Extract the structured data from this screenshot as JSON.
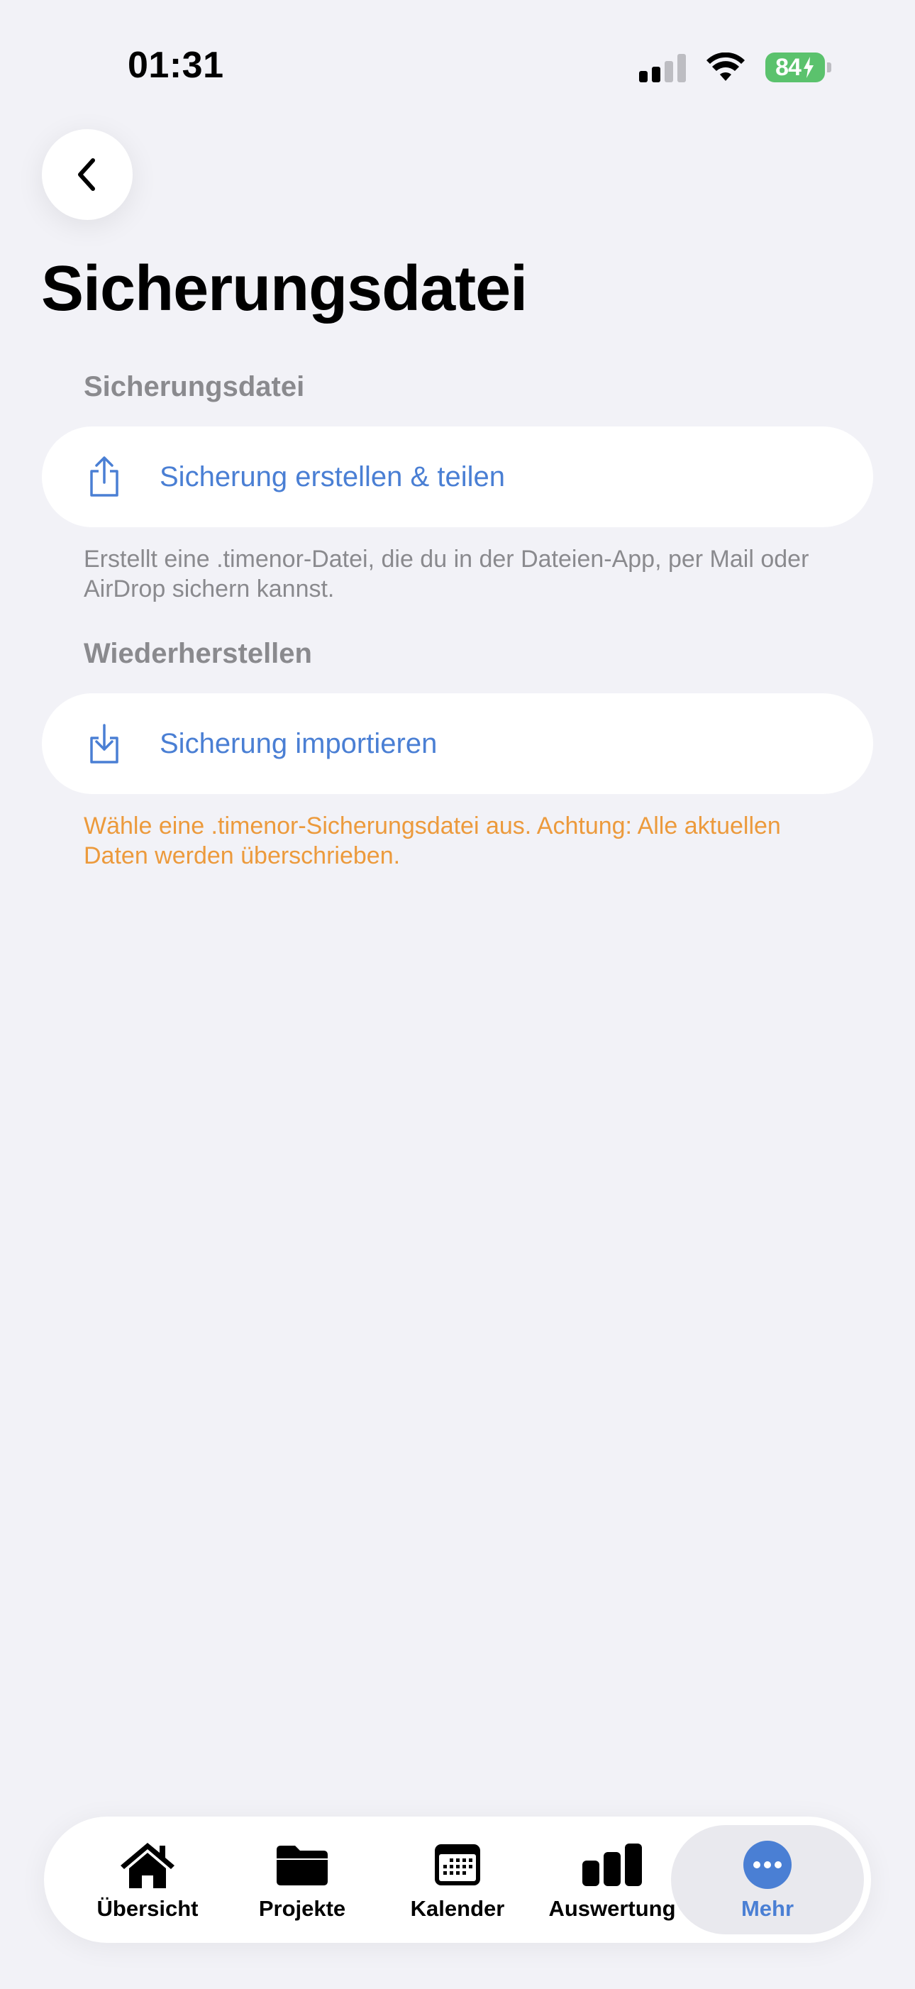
{
  "status_bar": {
    "time": "01:31",
    "battery": "84"
  },
  "page": {
    "title": "Sicherungsdatei"
  },
  "sections": [
    {
      "header": "Sicherungsdatei",
      "action_label": "Sicherung erstellen & teilen",
      "action_icon": "share-icon",
      "footnote": "Erstellt eine .timenor-Datei, die du in der Dateien-App, per Mail oder AirDrop sichern kannst."
    },
    {
      "header": "Wiederherstellen",
      "action_label": "Sicherung importieren",
      "action_icon": "import-icon",
      "footnote": "Wähle eine .timenor-Sicherungsdatei aus. Achtung: Alle aktuellen Daten werden überschrieben."
    }
  ],
  "tabs": [
    {
      "label": "Übersicht",
      "icon": "house-icon"
    },
    {
      "label": "Projekte",
      "icon": "folder-icon"
    },
    {
      "label": "Kalender",
      "icon": "calendar-icon"
    },
    {
      "label": "Auswertung",
      "icon": "chart-icon"
    },
    {
      "label": "Mehr",
      "icon": "more-icon",
      "active": true
    }
  ],
  "colors": {
    "accent": "#4A7FD4",
    "warning": "#EC9A3C",
    "secondary_text": "#8A8A8E",
    "background": "#F2F2F7",
    "battery": "#5BC26D"
  }
}
